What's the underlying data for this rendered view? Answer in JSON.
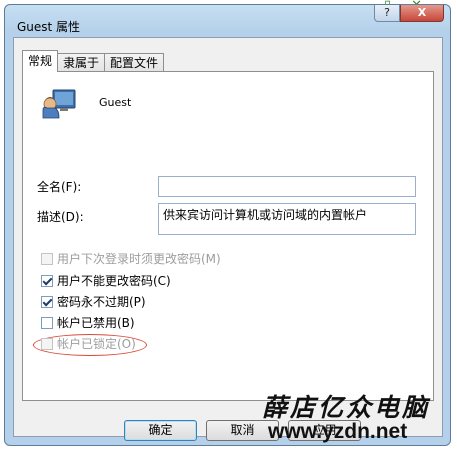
{
  "window": {
    "title": "Guest 属性",
    "help_label": "?",
    "close_label": "X"
  },
  "tabs": [
    {
      "label": "常规",
      "active": true
    },
    {
      "label": "隶属于",
      "active": false
    },
    {
      "label": "配置文件",
      "active": false
    }
  ],
  "user": {
    "name": "Guest",
    "icon": "user-account-icon"
  },
  "fields": {
    "fullname_label": "全名(F):",
    "fullname_value": "",
    "description_label": "描述(D):",
    "description_value": "供来宾访问计算机或访问域的内置帐户"
  },
  "checkboxes": [
    {
      "label": "用户下次登录时须更改密码(M)",
      "checked": false,
      "disabled": true
    },
    {
      "label": "用户不能更改密码(C)",
      "checked": true,
      "disabled": false
    },
    {
      "label": "密码永不过期(P)",
      "checked": true,
      "disabled": false
    },
    {
      "label": "帐户已禁用(B)",
      "checked": false,
      "disabled": false
    },
    {
      "label": "帐户已锁定(O)",
      "checked": false,
      "disabled": true
    }
  ],
  "buttons": {
    "ok": "确定",
    "cancel": "取消",
    "apply": "应用"
  },
  "watermark": {
    "line1": "薛店亿众电脑",
    "line2": "www.yzdn.net"
  },
  "top_icons": [
    "mobile-icon",
    "expand-icon"
  ],
  "colors": {
    "highlight_ellipse": "#d84a3a",
    "title_bar": "#c5dff2"
  }
}
